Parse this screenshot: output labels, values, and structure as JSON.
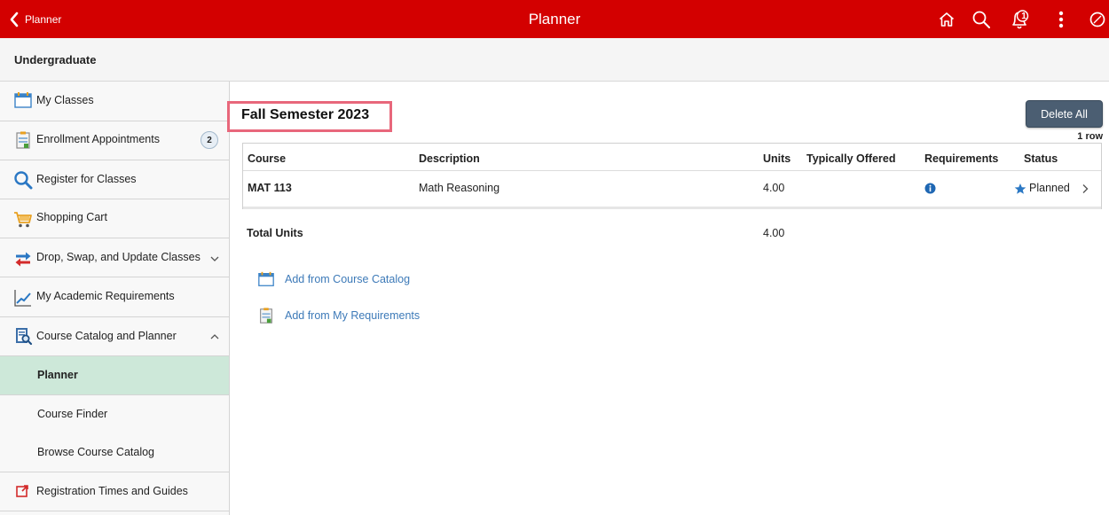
{
  "topbar": {
    "back_label": "Planner",
    "title": "Planner",
    "color": "#d30000",
    "notification_count": "1",
    "icons": [
      "home-icon",
      "search-icon",
      "notification-bell-icon",
      "actions-menu-icon",
      "navbar-compass-icon"
    ]
  },
  "subheader": {
    "title": "Undergraduate"
  },
  "sidebar": {
    "items": [
      {
        "label": "My Classes",
        "icon": "calendar-icon"
      },
      {
        "label": "Enrollment Appointments",
        "icon": "clipboard-icon",
        "badge": "2"
      },
      {
        "label": "Register for Classes",
        "icon": "search-icon"
      },
      {
        "label": "Shopping Cart",
        "icon": "cart-icon"
      },
      {
        "label": "Drop, Swap, and Update Classes",
        "icon": "swap-arrows-icon",
        "expanded": false
      },
      {
        "label": "My Academic Requirements",
        "icon": "chart-line-icon"
      },
      {
        "label": "Course Catalog and Planner",
        "icon": "catalog-search-icon",
        "expanded": true
      },
      {
        "label": "Planner",
        "active": true
      },
      {
        "label": "Course Finder"
      },
      {
        "label": "Browse Course Catalog"
      },
      {
        "label": "Registration Times and Guides",
        "icon": "external-link-icon"
      }
    ],
    "active_color": "#cde8d9"
  },
  "main": {
    "term_title": "Fall Semester 2023",
    "delete_all_label": "Delete All",
    "row_count": "1 row",
    "columns": [
      "Course",
      "Description",
      "Units",
      "Typically Offered",
      "Requirements",
      "Status"
    ],
    "rows": [
      {
        "course": "MAT 113",
        "description": "Math Reasoning",
        "units": "4.00",
        "typically_offered": "",
        "requirements_icon": "info-icon",
        "status": "Planned"
      }
    ],
    "total_label": "Total Units",
    "total_value": "4.00",
    "links": [
      {
        "label": "Add from Course Catalog",
        "icon": "calendar-icon"
      },
      {
        "label": "Add from My Requirements",
        "icon": "clipboard-icon"
      }
    ],
    "link_color": "#3d7ab8",
    "highlight_color": "#e8677b"
  }
}
